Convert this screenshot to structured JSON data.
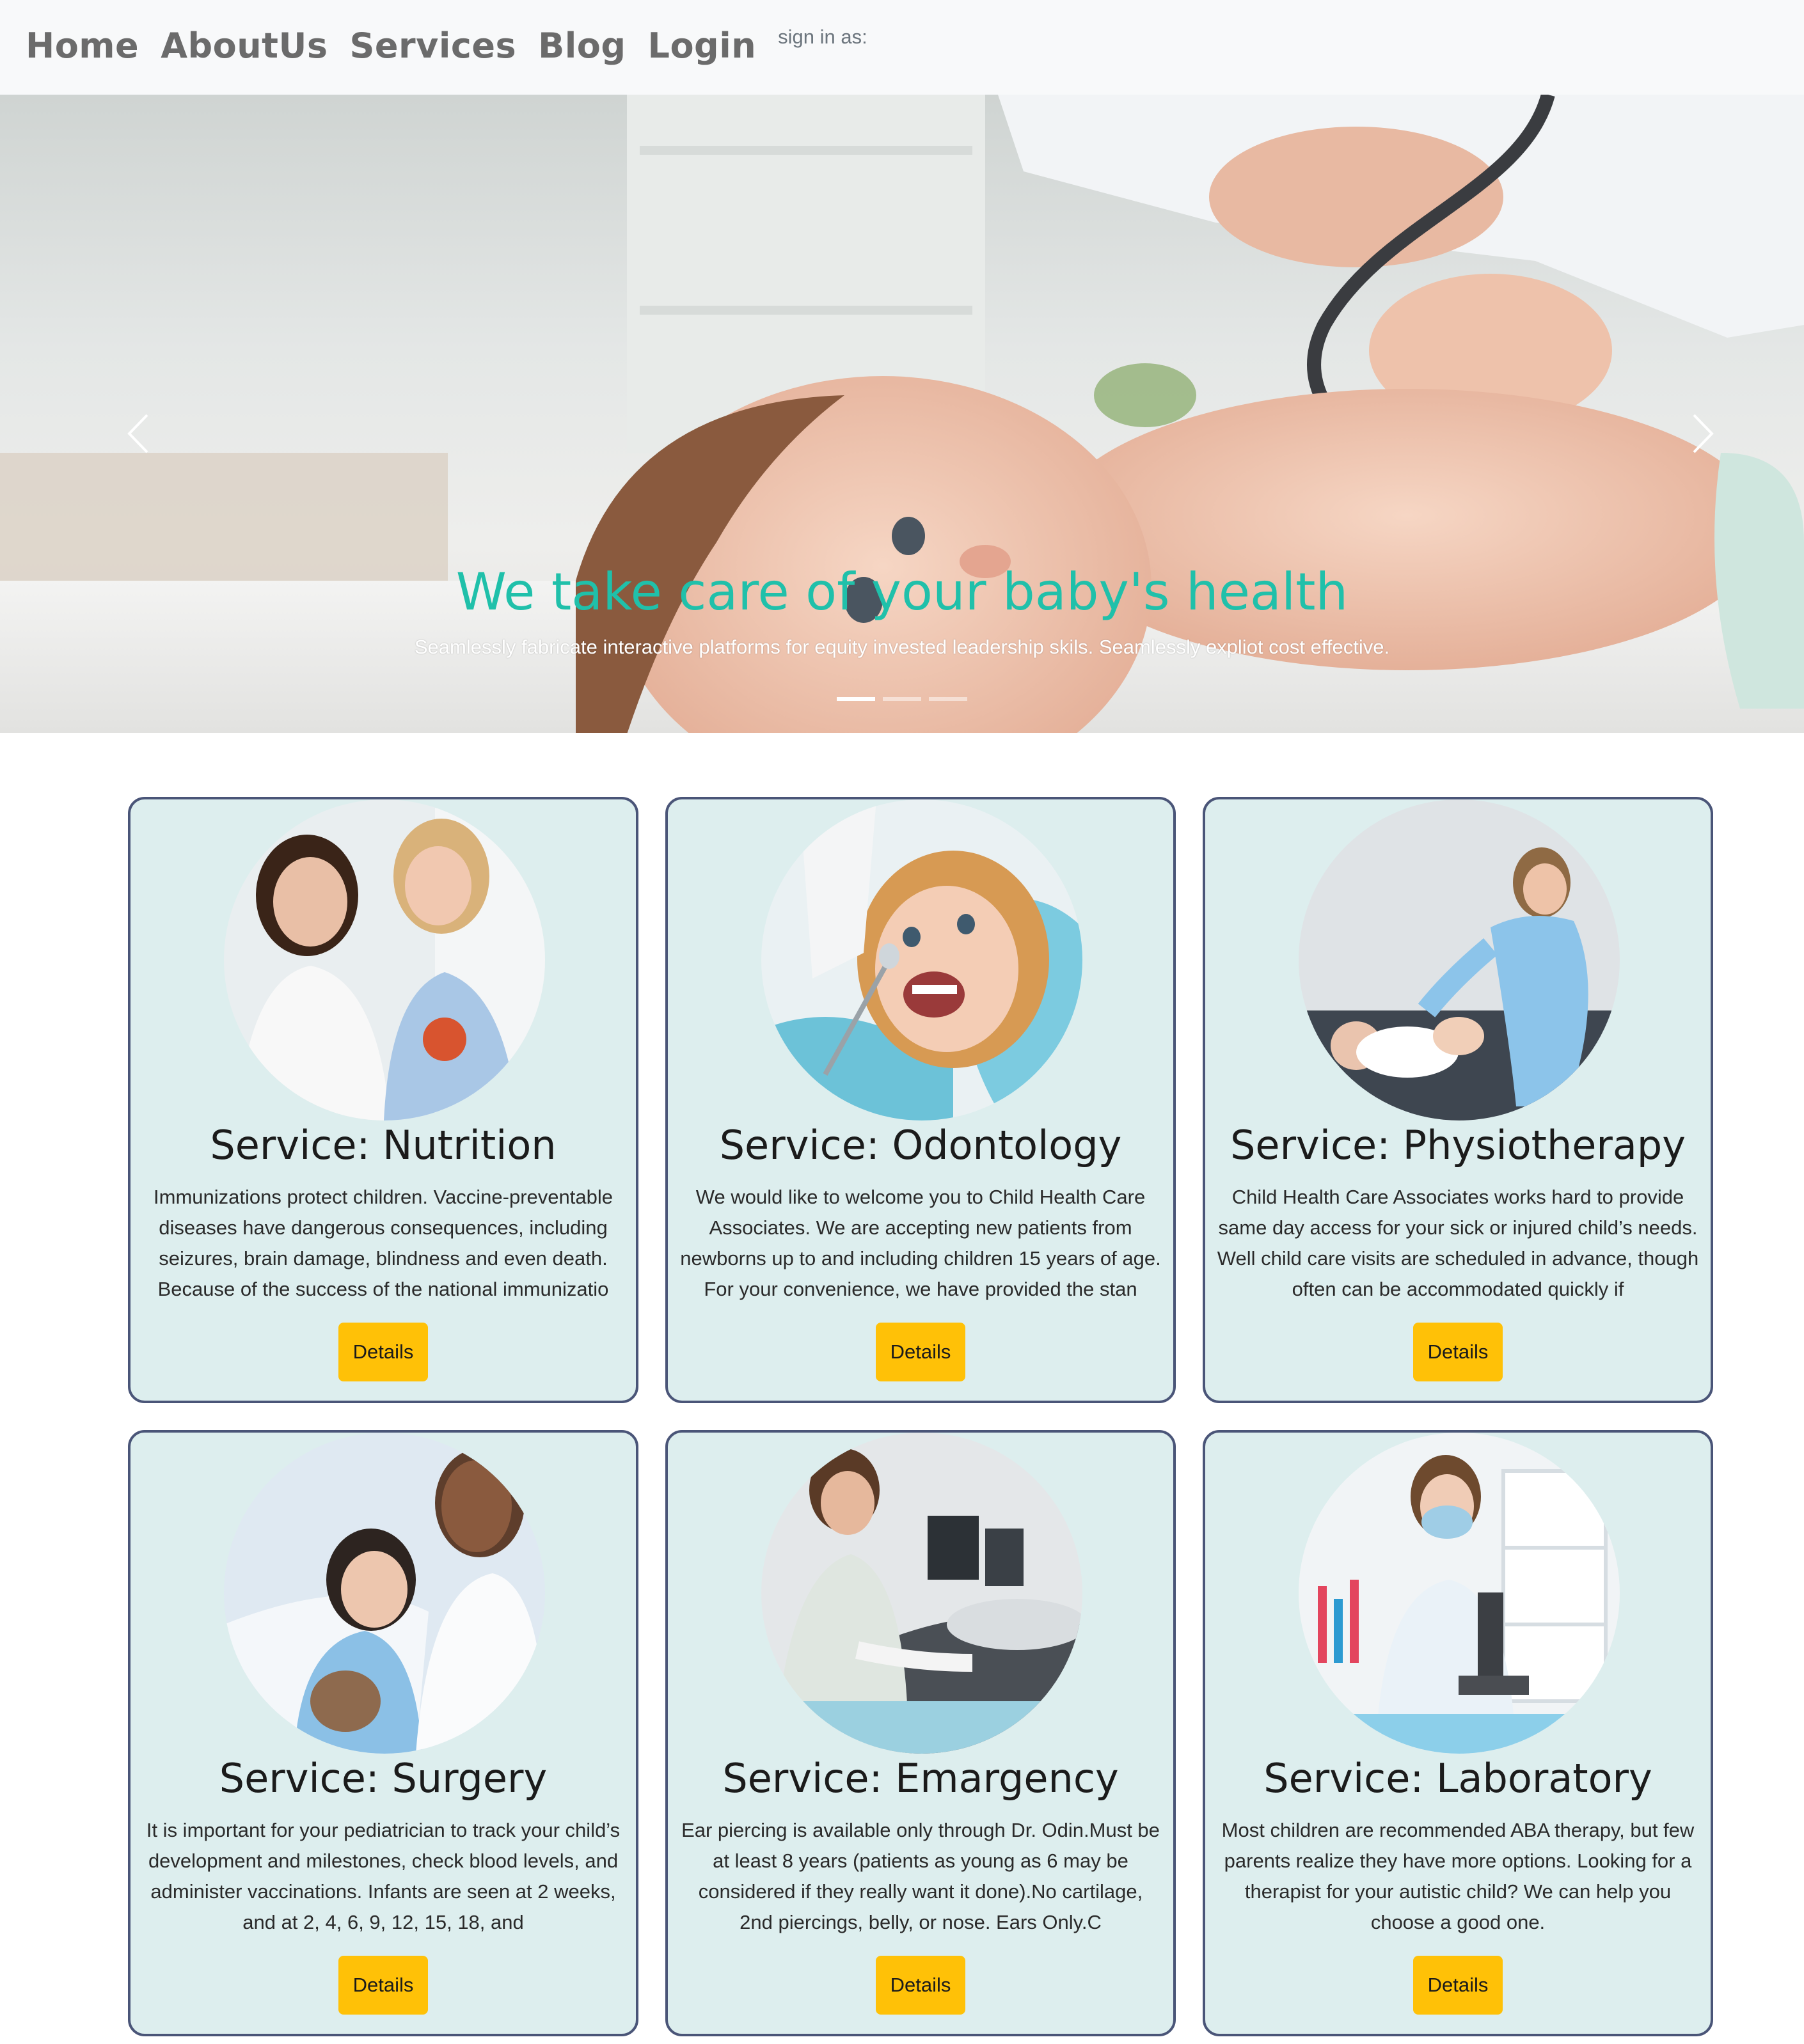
{
  "nav": {
    "links": [
      "Home",
      "AboutUs",
      "Services",
      "Blog",
      "Login"
    ],
    "signin_label": "sign in as:"
  },
  "hero": {
    "title": "We take care of your baby's health",
    "subtitle": "Seamlessly fabricate interactive platforms for equity invested leadership skils. Seamlessly expliot cost effective.",
    "slide_count": 3,
    "active_slide": 0
  },
  "services": [
    {
      "title": "Service: Nutrition",
      "text": "Immunizations protect children. Vaccine-preventable diseases have dangerous consequences, including seizures, brain damage, blindness and even death. Because of the success of the national immunizatio",
      "button": "Details"
    },
    {
      "title": "Service: Odontology",
      "text": "We would like to welcome you to Child Health Care Associates. We are accepting new patients from newborns up to and including children 15 years of age. For your convenience, we have provided the stan",
      "button": "Details"
    },
    {
      "title": "Service: Physiotherapy",
      "text": "Child Health Care Associates works hard to provide same day access for your sick or injured child’s needs. Well child care visits are scheduled in advance, though often can be accommodated quickly if",
      "button": "Details"
    },
    {
      "title": "Service: Surgery",
      "text": "It is important for your pediatrician to track your child’s development and milestones, check blood levels, and administer vaccinations. Infants are seen at 2 weeks, and at 2, 4, 6, 9, 12, 15, 18, and",
      "button": "Details"
    },
    {
      "title": "Service: Emargency",
      "text": "Ear piercing is available only through Dr. Odin.Must be at least 8 years (patients as young as 6 may be considered if they really want it done).No cartilage, 2nd piercings, belly, or nose. Ears Only.C",
      "button": "Details"
    },
    {
      "title": "Service: Laboratory",
      "text": "Most children are recommended ABA therapy, but few parents realize they have more options. Looking for a therapist for your autistic child? We can help you choose a good one.",
      "button": "Details"
    }
  ],
  "colors": {
    "accent_title": "#20c0aa",
    "card_bg": "#ddeeee",
    "card_border": "#4a5578",
    "button_bg": "#ffc107",
    "nav_bg": "#f8f9fa"
  },
  "icons": {
    "prev": "chevron-left-icon",
    "next": "chevron-right-icon"
  }
}
